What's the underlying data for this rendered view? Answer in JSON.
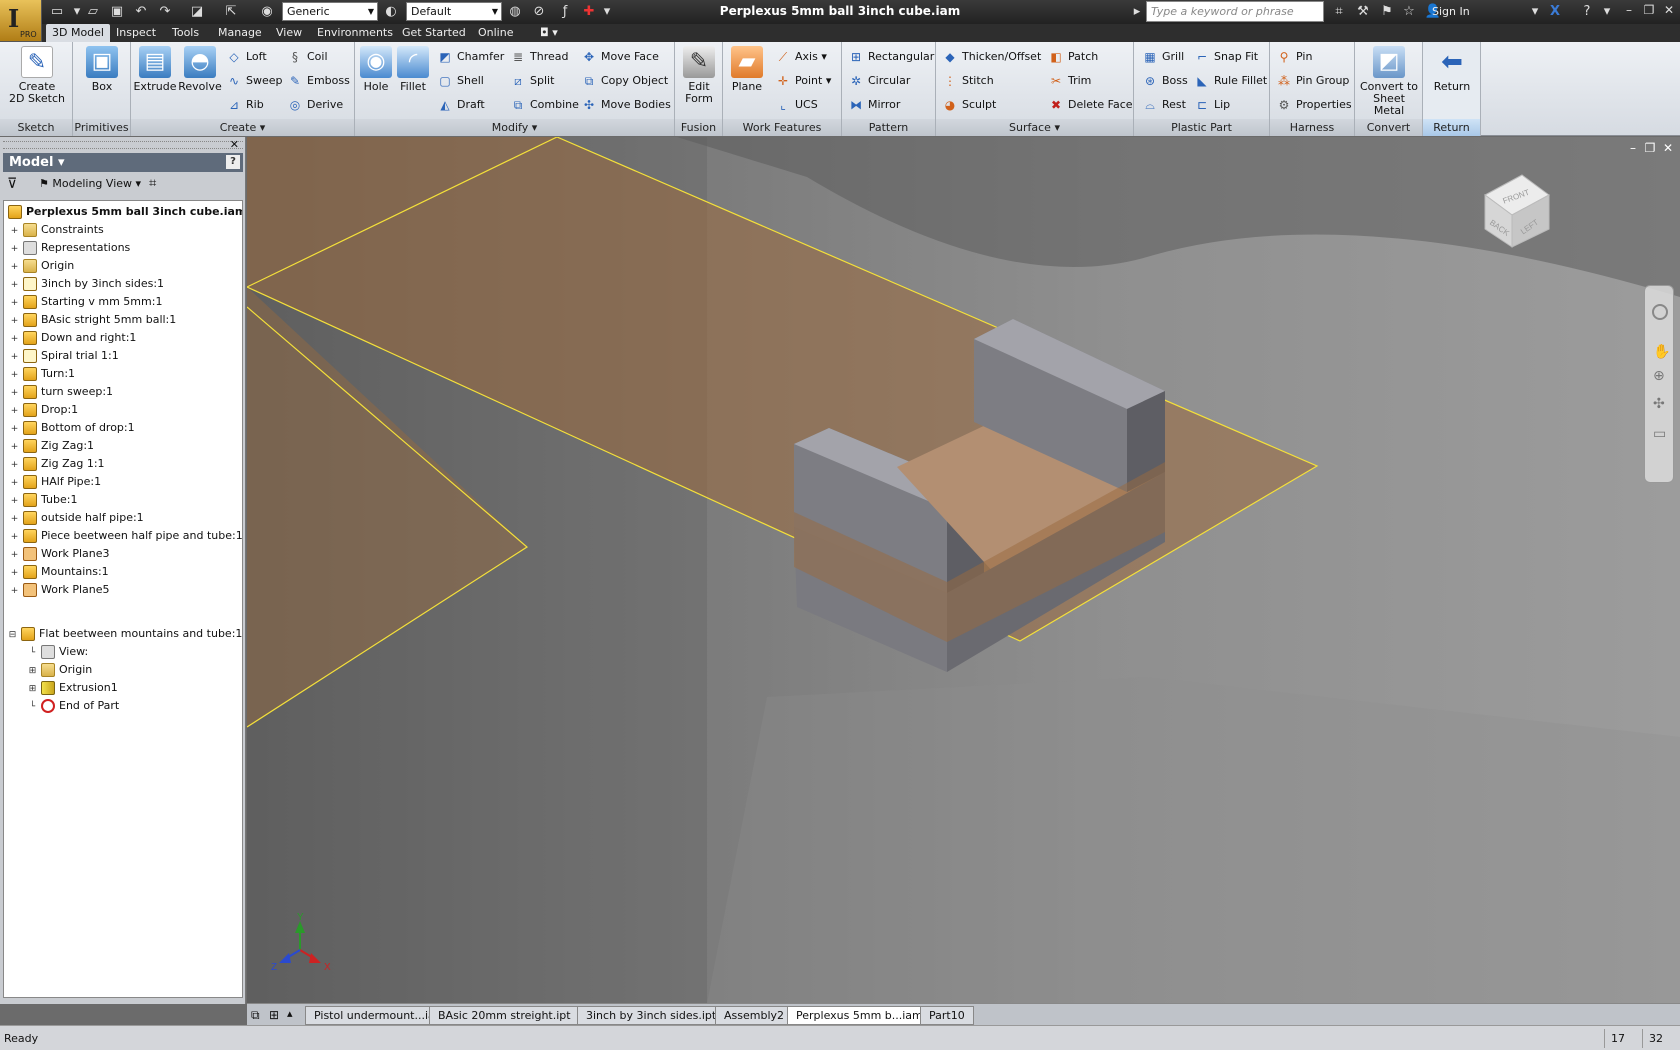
{
  "window": {
    "title": "Perplexus 5mm ball 3inch cube.iam",
    "app_edition": "PRO",
    "search_placeholder": "Type a keyword or phrase",
    "sign_in": "Sign In"
  },
  "quick_access": {
    "material": "Generic",
    "appearance": "Default"
  },
  "ribbon_tabs": [
    {
      "label": "3D Model",
      "active": true
    },
    {
      "label": "Inspect"
    },
    {
      "label": "Tools"
    },
    {
      "label": "Manage"
    },
    {
      "label": "View"
    },
    {
      "label": "Environments"
    },
    {
      "label": "Get Started"
    },
    {
      "label": "Online"
    }
  ],
  "ribbon": {
    "sketch": {
      "label": "Sketch",
      "create_2d_sketch": "Create\n2D Sketch"
    },
    "primitives": {
      "label": "Primitives",
      "box": "Box"
    },
    "create": {
      "label": "Create",
      "extrude": "Extrude",
      "revolve": "Revolve",
      "loft": "Loft",
      "sweep": "Sweep",
      "rib": "Rib",
      "coil": "Coil",
      "emboss": "Emboss",
      "derive": "Derive"
    },
    "modify": {
      "label": "Modify",
      "hole": "Hole",
      "fillet": "Fillet",
      "chamfer": "Chamfer",
      "shell": "Shell",
      "draft": "Draft",
      "thread": "Thread",
      "split": "Split",
      "combine": "Combine",
      "move_face": "Move Face",
      "copy_object": "Copy Object",
      "move_bodies": "Move Bodies"
    },
    "fusion": {
      "label": "Fusion",
      "edit_form": "Edit\nForm"
    },
    "work_features": {
      "label": "Work Features",
      "plane": "Plane",
      "axis": "Axis",
      "point": "Point",
      "ucs": "UCS"
    },
    "pattern": {
      "label": "Pattern",
      "rectangular": "Rectangular",
      "circular": "Circular",
      "mirror": "Mirror"
    },
    "surface": {
      "label": "Surface",
      "thicken_offset": "Thicken/Offset",
      "stitch": "Stitch",
      "sculpt": "Sculpt",
      "patch": "Patch",
      "trim": "Trim",
      "delete_face": "Delete Face"
    },
    "plastic_part": {
      "label": "Plastic Part",
      "grill": "Grill",
      "boss": "Boss",
      "rest": "Rest",
      "snap_fit": "Snap Fit",
      "rule_fillet": "Rule Fillet",
      "lip": "Lip"
    },
    "harness": {
      "label": "Harness",
      "pin": "Pin",
      "pin_group": "Pin Group",
      "properties": "Properties"
    },
    "convert": {
      "label": "Convert",
      "convert_to_sheet_metal": "Convert to\nSheet Metal"
    },
    "return": {
      "label": "Return",
      "return": "Return"
    }
  },
  "browser": {
    "title": "Model",
    "view_mode": "Modeling View",
    "root": "Perplexus 5mm ball 3inch cube.iam",
    "items": [
      {
        "label": "Constraints",
        "icon": "folder"
      },
      {
        "label": "Representations",
        "icon": "rep"
      },
      {
        "label": "Origin",
        "icon": "folder"
      },
      {
        "label": "3inch by 3inch sides:1",
        "icon": "sketch"
      },
      {
        "label": "Starting v mm 5mm:1",
        "icon": "part"
      },
      {
        "label": "BAsic stright 5mm ball:1",
        "icon": "part"
      },
      {
        "label": "Down and right:1",
        "icon": "part"
      },
      {
        "label": "Spiral trial 1:1",
        "icon": "sketch"
      },
      {
        "label": "Turn:1",
        "icon": "part"
      },
      {
        "label": "turn sweep:1",
        "icon": "part"
      },
      {
        "label": "Drop:1",
        "icon": "part"
      },
      {
        "label": "Bottom of drop:1",
        "icon": "part"
      },
      {
        "label": "Zig Zag:1",
        "icon": "part"
      },
      {
        "label": "Zig Zag 1:1",
        "icon": "part"
      },
      {
        "label": "HAlf Pipe:1",
        "icon": "part"
      },
      {
        "label": "Tube:1",
        "icon": "part"
      },
      {
        "label": "outside half pipe:1",
        "icon": "part"
      },
      {
        "label": "Piece beetween half pipe and tube:1",
        "icon": "part"
      },
      {
        "label": "Work Plane3",
        "icon": "plane"
      },
      {
        "label": "Mountains:1",
        "icon": "part"
      },
      {
        "label": "Work Plane5",
        "icon": "plane"
      }
    ],
    "active_part": "Flat beetween mountains and tube:1",
    "children": [
      {
        "label": "View:",
        "icon": "rep"
      },
      {
        "label": "Origin",
        "icon": "folder"
      },
      {
        "label": "Extrusion1",
        "icon": "ext"
      },
      {
        "label": "End of Part",
        "icon": "err"
      }
    ]
  },
  "viewcube": {
    "top": "FRONT",
    "back": "BACK",
    "left": "LEFT"
  },
  "triad": {
    "x": "X",
    "y": "Y",
    "z": "Z"
  },
  "doc_tabs": [
    {
      "label": "Pistol undermount...iam"
    },
    {
      "label": "BAsic 20mm streight.ipt"
    },
    {
      "label": "3inch by 3inch sides.ipt"
    },
    {
      "label": "Assembly2"
    },
    {
      "label": "Perplexus 5mm b...iam",
      "active": true
    },
    {
      "label": "Part10"
    }
  ],
  "status": {
    "text": "Ready",
    "count1": "17",
    "count2": "32"
  },
  "colors": {
    "accent": "#2b64b8",
    "plane": "#a87a4e",
    "selection": "#f4e03a"
  }
}
